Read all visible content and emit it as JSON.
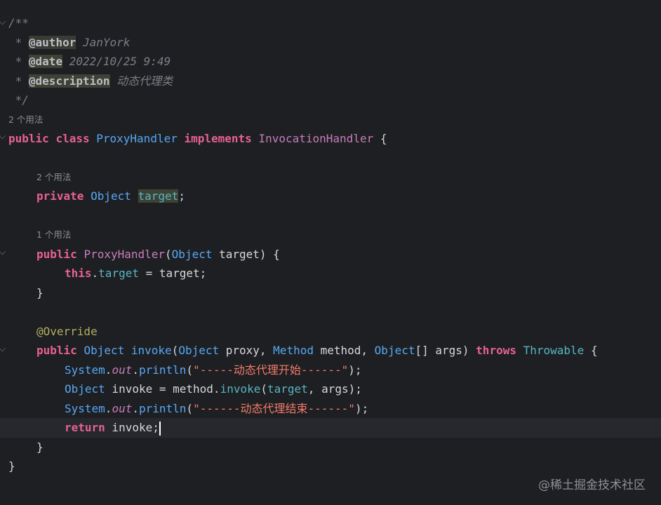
{
  "code": {
    "comment": {
      "open": "/**",
      "author_tag": "@author",
      "author_value": " JanYork",
      "date_tag": "@date",
      "date_value": " 2022/10/25 9:49",
      "description_tag": "@description",
      "description_value": " 动态代理类",
      "star": " * ",
      "close": " */"
    },
    "usages": {
      "class": "2 个用法",
      "field": "2 个用法",
      "constructor": "1 个用法"
    },
    "class_decl": {
      "public": "public",
      "class": "class",
      "name": "ProxyHandler",
      "implements": "implements",
      "interface": "InvocationHandler",
      "brace": " {"
    },
    "field": {
      "private": "private",
      "type": "Object",
      "name": "target",
      "semi": ";"
    },
    "constructor": {
      "public": "public",
      "name": "ProxyHandler",
      "open": "(",
      "param_type": "Object",
      "param_rest": " target) {",
      "this": "this",
      "dot": ".",
      "field": "target",
      "assign": " = target;",
      "close": "}"
    },
    "override": "@Override",
    "method": {
      "public": "public",
      "ret_type": "Object",
      "name": "invoke",
      "open": "(",
      "p1_type": "Object",
      "p1_rest": " proxy, ",
      "p2_type": "Method",
      "p2_rest": " method, ",
      "p3_type": "Object",
      "p3_rest": "[] args) ",
      "throws": "throws",
      "throwable": "Throwable",
      "brace": " {",
      "close": "}"
    },
    "stmt1": {
      "sys": "System",
      "dot1": ".",
      "out": "out",
      "dot2": ".",
      "println": "println",
      "open": "(",
      "str": "\"-----动态代理开始------\"",
      "close": ");"
    },
    "stmt2": {
      "type": "Object",
      "mid": " invoke = method.",
      "invoke": "invoke",
      "open": "(",
      "target": "target",
      "rest": ", args);"
    },
    "stmt3": {
      "sys": "System",
      "dot1": ".",
      "out": "out",
      "dot2": ".",
      "println": "println",
      "open": "(",
      "str": "\"------动态代理结束------\"",
      "close": ");"
    },
    "stmt4": {
      "return": "return",
      "rest": " invoke;"
    },
    "class_close": "}"
  },
  "watermark": "@稀土掘金技术社区",
  "colors": {
    "background": "#1e1f22",
    "keyword": "#e7628f",
    "type": "#56a8f5",
    "string": "#f27b6b",
    "field": "#c77dbb",
    "annotation": "#b3ae60",
    "comment": "#7a7e85"
  }
}
